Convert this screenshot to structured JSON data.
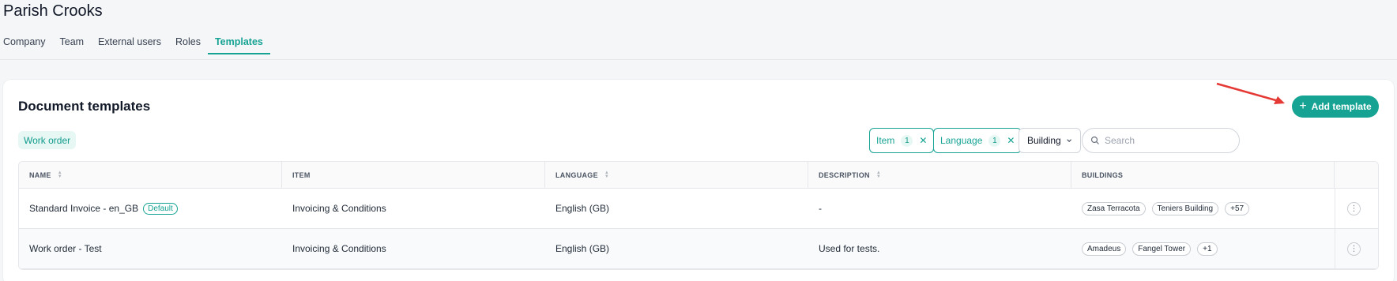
{
  "page": {
    "title": "Parish Crooks"
  },
  "tabs": [
    {
      "label": "Company"
    },
    {
      "label": "Team"
    },
    {
      "label": "External users"
    },
    {
      "label": "Roles"
    },
    {
      "label": "Templates",
      "active": true
    }
  ],
  "section": {
    "title": "Document templates",
    "add_button": "Add template",
    "active_chip": "Work order"
  },
  "filters": {
    "item": {
      "label": "Item",
      "count": "1"
    },
    "language": {
      "label": "Language",
      "count": "1"
    },
    "building": {
      "label": "Building"
    },
    "search_placeholder": "Search"
  },
  "table": {
    "headers": [
      "NAME",
      "ITEM",
      "LANGUAGE",
      "DESCRIPTION",
      "BUILDINGS"
    ],
    "rows": [
      {
        "name": "Standard Invoice - en_GB",
        "badge": "Default",
        "item": "Invoicing & Conditions",
        "language": "English (GB)",
        "description": "-",
        "buildings": [
          "Zasa Terracota",
          "Teniers Building"
        ],
        "more": "+57"
      },
      {
        "name": "Work order - Test",
        "item": "Invoicing & Conditions",
        "language": "English (GB)",
        "description": "Used for tests.",
        "buildings": [
          "Amadeus",
          "Fangel Tower"
        ],
        "more": "+1"
      }
    ]
  },
  "colors": {
    "accent": "#16a394",
    "annotation_arrow": "#e53935"
  },
  "icons": [
    "plus-icon",
    "close-icon",
    "chevron-down-icon",
    "search-icon",
    "sort-icon",
    "more-vertical-icon",
    "arrow-annotation"
  ]
}
